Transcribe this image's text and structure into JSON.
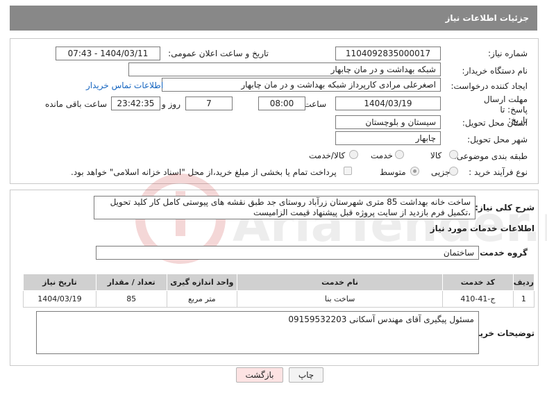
{
  "header": {
    "title": "جزئیات اطلاعات نیاز"
  },
  "labels": {
    "need_number": "شماره نیاز:",
    "announce_datetime": "تاریخ و ساعت اعلان عمومی:",
    "buyer_org": "نام دستگاه خریدار:",
    "requester": "ایجاد کننده درخواست:",
    "deadline": "مهلت ارسال پاسخ: تا تاریخ:",
    "time_word": "ساعت",
    "day_and": "روز و",
    "time_remaining": "ساعت باقی مانده",
    "province": "استان محل تحویل:",
    "city": "شهر محل تحویل:",
    "category": "طبقه بندی موضوعی:",
    "process_type": "نوع فرآیند خرید :",
    "general_desc": "شرح کلی نیاز:",
    "services_info": "اطلاعات خدمات مورد نیاز",
    "service_group": "گروه خدمت:",
    "buyer_notes": "توضیحات خریدار:"
  },
  "values": {
    "need_number": "1104092835000017",
    "announce_datetime": "1404/03/11 - 07:43",
    "buyer_org": "شبکه بهداشت و در مان چابهار",
    "requester": "اصغرعلی مرادی کارپرداز شبکه بهداشت و در مان چابهار",
    "buyer_contact_link": "اطلاعات تماس خریدار",
    "deadline_date": "1404/03/19",
    "deadline_time": "08:00",
    "days_remaining": "7",
    "time_remaining": "23:42:35",
    "province": "سیستان و بلوچستان",
    "city": "چابهار",
    "general_desc": "ساخت خانه بهداشت 85 متری شهرستان زرآباد روستای جد طبق نقشه های پیوستی کامل کار کلید تحویل ،تکمیل فرم بازدید از سایت پروژه قبل پیشنهاد قیمت الزامیست",
    "service_group": "ساختمان",
    "buyer_notes": "مسئول پیگیری آقای مهندس آسکانی 09159532203"
  },
  "category_options": [
    {
      "label": "کالا",
      "selected": false
    },
    {
      "label": "خدمت",
      "selected": false
    },
    {
      "label": "کالا/خدمت",
      "selected": false
    }
  ],
  "process_options": [
    {
      "label": "جزیی",
      "selected": false
    },
    {
      "label": "متوسط",
      "selected": true
    }
  ],
  "payment_note": "پرداخت تمام یا بخشی از مبلغ خرید،از محل \"اسناد خزانه اسلامی\" خواهد بود.",
  "table": {
    "headers": [
      "ردیف",
      "کد خدمت",
      "نام خدمت",
      "واحد اندازه گیری",
      "تعداد / مقدار",
      "تاریخ نیاز"
    ],
    "rows": [
      [
        "1",
        "ج-41-410",
        "ساخت بنا",
        "متر مربع",
        "85",
        "1404/03/19"
      ]
    ]
  },
  "buttons": {
    "print": "چاپ",
    "back": "بازگشت"
  },
  "watermark_text": "AriaTender.neT",
  "colors": {
    "header_bg": "#888888",
    "link": "#1565c0",
    "back_button_bg": "#fde3e3",
    "watermark": "#c62828"
  }
}
